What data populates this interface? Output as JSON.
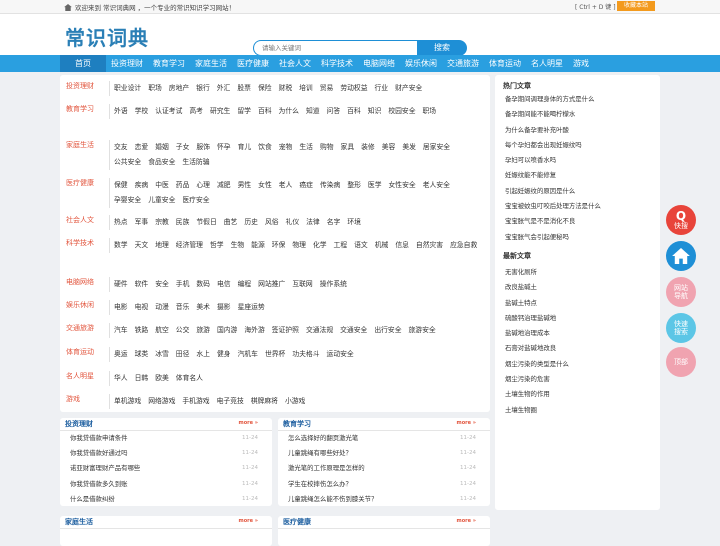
{
  "topbar": {
    "welcome": "欢迎来到 常识词典网 ，一个专业的常识知识学习网站！",
    "shortcut": "[ Ctrl + D 键 ]",
    "fav": "收藏本站"
  },
  "header": {
    "logo": "常识词典",
    "search_placeholder": "请输入关键词",
    "search_button": "搜索"
  },
  "nav": [
    "首页",
    "投资理财",
    "教育学习",
    "家庭生活",
    "医疗健康",
    "社会人文",
    "科学技术",
    "电脑网络",
    "娱乐休闲",
    "交通旅游",
    "体育运动",
    "名人明星",
    "游戏"
  ],
  "categories": [
    {
      "name": "投资理财",
      "items": [
        "职业设计",
        "职场",
        "房地产",
        "银行",
        "外汇",
        "股票",
        "保险",
        "财税",
        "培训",
        "贸易",
        "劳动权益",
        "行业",
        "财产安全"
      ]
    },
    {
      "name": "教育学习",
      "items": [
        "外语",
        "学校",
        "认证考试",
        "高考",
        "研究生",
        "留学",
        "百科",
        "为什么",
        "知道",
        "问答",
        "百科",
        "知识",
        "校园安全",
        "职场"
      ]
    },
    {
      "name": "家庭生活",
      "items": [
        "交友",
        "恋爱",
        "婚姻",
        "子女",
        "服饰",
        "怀孕",
        "育儿",
        "饮食",
        "宠物",
        "生活",
        "购物",
        "家具",
        "装修",
        "美容",
        "美发",
        "居家安全",
        "公共安全",
        "食品安全",
        "生活防骗"
      ]
    },
    {
      "name": "医疗健康",
      "items": [
        "保健",
        "疾病",
        "中医",
        "药品",
        "心理",
        "减肥",
        "男性",
        "女性",
        "老人",
        "癌症",
        "传染病",
        "整形",
        "医学",
        "女性安全",
        "老人安全",
        "孕婴安全",
        "儿童安全",
        "医疗安全"
      ]
    },
    {
      "name": "社会人文",
      "items": [
        "热点",
        "军事",
        "宗教",
        "民族",
        "节假日",
        "曲艺",
        "历史",
        "风俗",
        "礼仪",
        "法律",
        "名字",
        "环境"
      ]
    },
    {
      "name": "科学技术",
      "items": [
        "数学",
        "天文",
        "地理",
        "经济管理",
        "哲学",
        "生物",
        "能源",
        "环保",
        "物理",
        "化学",
        "工程",
        "语文",
        "机械",
        "信息",
        "自然灾害",
        "应急自救"
      ]
    },
    {
      "name": "电脑网络",
      "items": [
        "硬件",
        "软件",
        "安全",
        "手机",
        "数码",
        "电信",
        "编程",
        "网站推广",
        "互联网",
        "操作系统"
      ]
    },
    {
      "name": "娱乐休闲",
      "items": [
        "电影",
        "电视",
        "动漫",
        "音乐",
        "美术",
        "摄影",
        "星座运势"
      ]
    },
    {
      "name": "交通旅游",
      "items": [
        "汽车",
        "铁路",
        "航空",
        "公交",
        "旅游",
        "国内游",
        "海外游",
        "签证护照",
        "交通法规",
        "交通安全",
        "出行安全",
        "旅游安全"
      ]
    },
    {
      "name": "体育运动",
      "items": [
        "奥运",
        "球类",
        "冰雪",
        "田径",
        "水上",
        "健身",
        "汽机车",
        "世界杯",
        "功夫格斗",
        "运动安全"
      ]
    },
    {
      "name": "名人明星",
      "items": [
        "华人",
        "日韩",
        "欧美",
        "体育名人"
      ]
    },
    {
      "name": "游戏",
      "items": [
        "单机游戏",
        "网络游戏",
        "手机游戏",
        "电子竞技",
        "棋牌麻将",
        "小游戏"
      ]
    }
  ],
  "sidebar": {
    "hot_title": "热门文章",
    "hot": [
      "备孕期间调理身体的方式是什么",
      "备孕期间能不能喝柠檬水",
      "为什么备孕要补充叶酸",
      "每个孕妇都会出现妊娠纹吗",
      "孕妇可以喷香水吗",
      "妊娠纹能不能修复",
      "引起妊娠纹的原因是什么",
      "宝宝被蚊虫叮咬后处理方法是什么",
      "宝宝胀气是不是消化不良",
      "宝宝胀气会引起便秘吗"
    ],
    "new_title": "最新文章",
    "new": [
      "无害化厕所",
      "改良盐碱土",
      "盐碱土特点",
      "硫酸钙治理盐碱地",
      "盐碱地治理成本",
      "石膏对盐碱地改良",
      "烟尘污染的类型是什么",
      "烟尘污染的危害",
      "土壤生物的作用",
      "土壤生物圈"
    ]
  },
  "panels": [
    {
      "title": "投资理财",
      "more": "more »",
      "items": [
        "你我贷借款申请条件",
        "你我贷借款好通过吗",
        "诺亚财富理财产品有哪些",
        "你我贷借款多久到账",
        "什么是借款纠纷"
      ],
      "date": "11-24"
    },
    {
      "title": "教育学习",
      "more": "more »",
      "items": [
        "怎么选择好的翻页激光笔",
        "儿童跳绳有哪些好处？",
        "激光笔的工作原理是怎样的",
        "学生在校摔伤怎么办？",
        "儿童跳绳怎么能不伤到膝关节？"
      ],
      "date": "11-24"
    },
    {
      "title": "家庭生活",
      "more": "more »",
      "items": [],
      "date": ""
    },
    {
      "title": "医疗健康",
      "more": "more »",
      "items": [],
      "date": ""
    }
  ],
  "floats": [
    {
      "label": "快搜",
      "color": "#e8443a",
      "icon": "q-logo-icon"
    },
    {
      "label": "",
      "color": "#1e8fd6",
      "icon": "home-icon"
    },
    {
      "label": "网站导航",
      "color": "#f0a3b0",
      "icon": ""
    },
    {
      "label": "快速搜索",
      "color": "#5cc6e6",
      "icon": ""
    },
    {
      "label": "顶部",
      "color": "#f0a3b0",
      "icon": ""
    }
  ]
}
